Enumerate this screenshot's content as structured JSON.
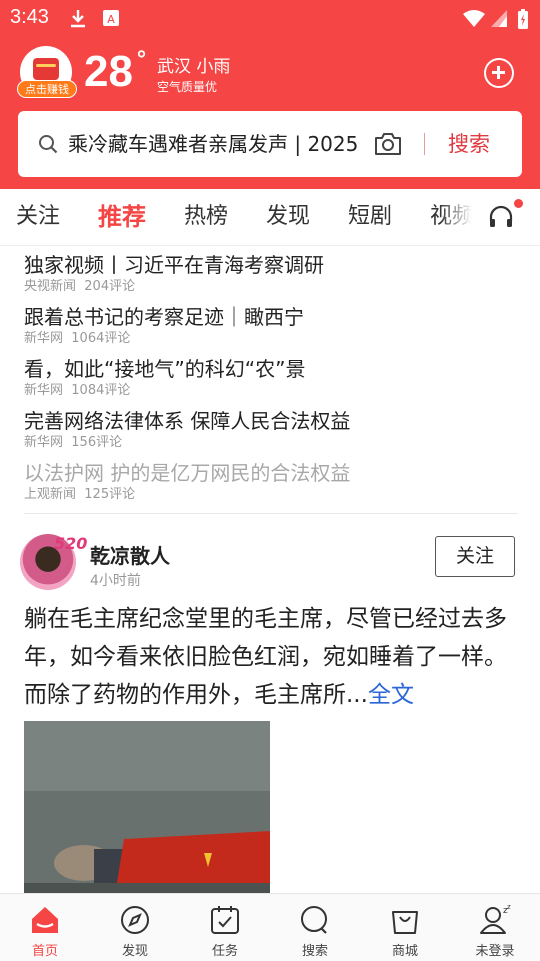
{
  "status_bar": {
    "time": "3:43"
  },
  "weather": {
    "earn_label": "点击赚钱",
    "temperature": "28",
    "degree_symbol": "°",
    "city_condition": "武汉 小雨",
    "air_quality": "空气质量优"
  },
  "search": {
    "query": "乘冷藏车遇难者亲属发声 | 2025",
    "button_label": "搜索"
  },
  "tabs": [
    {
      "label": "关注"
    },
    {
      "label": "推荐",
      "active": true
    },
    {
      "label": "热榜"
    },
    {
      "label": "发现"
    },
    {
      "label": "短剧"
    },
    {
      "label": "视频"
    }
  ],
  "news": [
    {
      "title": "独家视频丨习近平在青海考察调研",
      "source": "央视新闻",
      "comments": "204评论"
    },
    {
      "title": "跟着总书记的考察足迹｜瞰西宁",
      "source": "新华网",
      "comments": "1064评论"
    },
    {
      "title": "看，如此“接地气”的科幻“农”景",
      "source": "新华网",
      "comments": "1084评论"
    },
    {
      "title": "完善网络法律体系 保障人民合法权益",
      "source": "新华网",
      "comments": "156评论"
    },
    {
      "title": "以法护网 护的是亿万网民的合法权益",
      "source": "上观新闻",
      "comments": "125评论"
    }
  ],
  "post": {
    "badge": "520",
    "author": "乾凉散人",
    "time": "4小时前",
    "follow_label": "关注",
    "text": "躺在毛主席纪念堂里的毛主席，尽管已经过去多年，如今看来依旧脸色红润，宛如睡着了一样。而除了药物的作用外，毛主席所...",
    "more_label": "全文"
  },
  "bottom_nav": [
    {
      "label": "首页",
      "icon": "home-icon",
      "active": true
    },
    {
      "label": "发现",
      "icon": "compass-icon"
    },
    {
      "label": "任务",
      "icon": "task-calendar-icon"
    },
    {
      "label": "搜索",
      "icon": "search-icon"
    },
    {
      "label": "商城",
      "icon": "shopping-bag-icon"
    },
    {
      "label": "未登录",
      "icon": "user-sleep-icon"
    }
  ],
  "colors": {
    "brand_red": "#f54545",
    "link_blue": "#2a66d6"
  }
}
